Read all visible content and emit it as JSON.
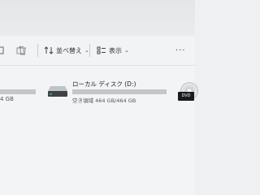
{
  "toolbar": {
    "sort_label": "並べ替え",
    "view_label": "表示",
    "more_label": "···"
  },
  "drives": [
    {
      "size_text": "4 GB"
    },
    {
      "name": "ローカル ディスク (D:)",
      "size_text": "空き領域 464 GB/464 GB",
      "used_fraction": 0.0
    },
    {
      "badge": "DVD"
    }
  ],
  "icons": {
    "back_icon": "folder-outline-icon",
    "share_icon": "share-icon",
    "delete_icon": "trash-icon",
    "sort_icon": "sort-arrows-icon",
    "view_icon": "view-grid-icon",
    "drive_icon": "hard-drive-icon",
    "dvd_icon": "dvd-drive-icon"
  }
}
